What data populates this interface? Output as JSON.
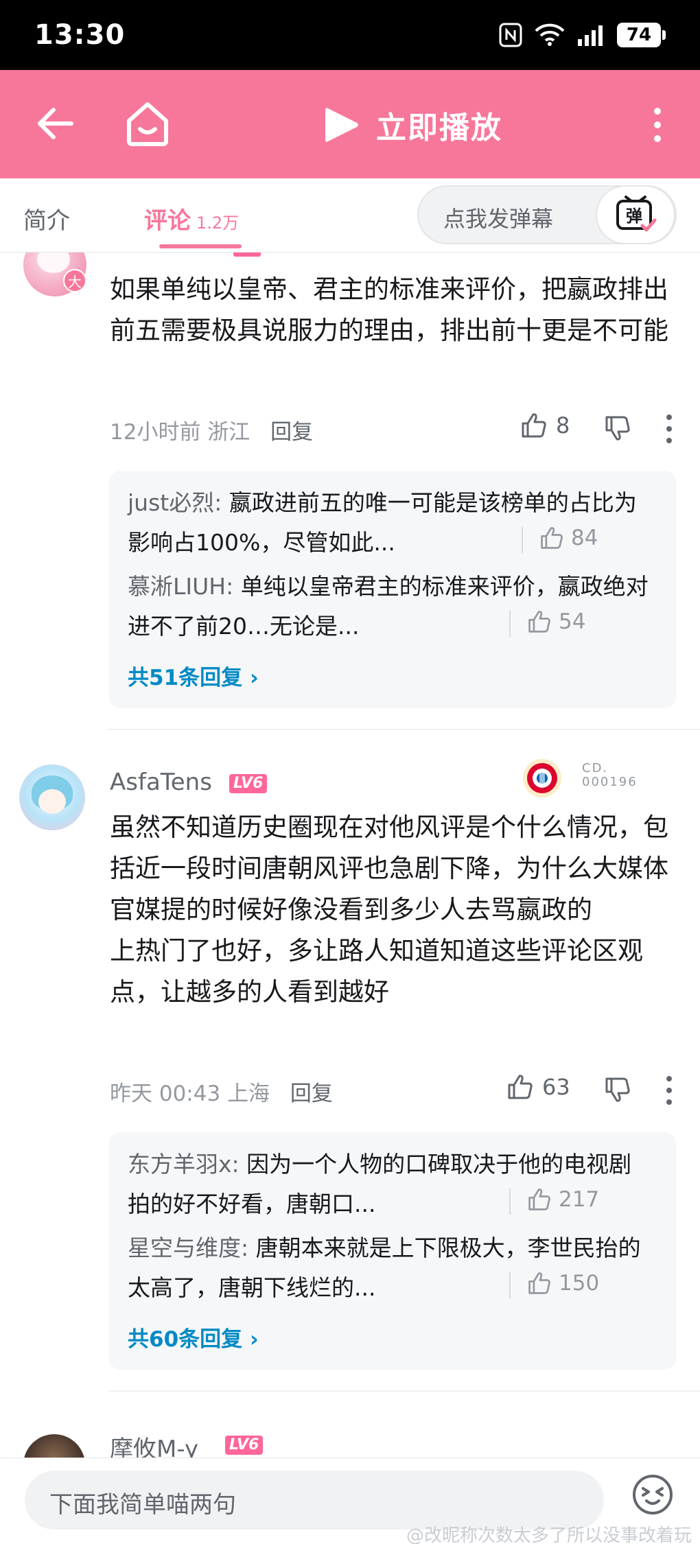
{
  "status_bar": {
    "time": "13:30",
    "battery": "74"
  },
  "toolbar": {
    "play_label": "立即播放"
  },
  "tabs": {
    "intro_label": "简介",
    "comments_label": "评论",
    "comments_count": "1.2万",
    "danmaku_placeholder": "点我发弹幕",
    "danmaku_button": "弹"
  },
  "comments": [
    {
      "badge": "大",
      "text": "如果单纯以皇帝、君主的标准来评价，把嬴政排出前五需要极具说服力的理由，排出前十更是不可能",
      "time": "12小时前",
      "location": "浙江",
      "reply_label": "回复",
      "likes": "8",
      "replies": [
        {
          "name": "just必烈",
          "text": "嬴政进前五的唯一可能是该榜单的占比为影响占100%，尽管如此...",
          "likes": "84"
        },
        {
          "name": "慕淅LIUH",
          "text": "单纯以皇帝君主的标准来评价，嬴政绝对进不了前20…无论是...",
          "likes": "54"
        }
      ],
      "more_replies": "共51条回复"
    },
    {
      "username": "AsfaTens",
      "level": "LV6",
      "fan_id_line1": "CD.",
      "fan_id_line2": "000196",
      "text": "虽然不知道历史圈现在对他风评是个什么情况，包括近一段时间唐朝风评也急剧下降，为什么大媒体官媒提的时候好像没看到多少人去骂嬴政的\n上热门了也好，多让路人知道知道这些评论区观点，让越多的人看到越好",
      "time": "昨天 00:43",
      "location": "上海",
      "reply_label": "回复",
      "likes": "63",
      "replies": [
        {
          "name": "东方羊羽x",
          "text": "因为一个人物的口碑取决于他的电视剧拍的好不好看，唐朝口...",
          "likes": "217"
        },
        {
          "name": "星空与维度",
          "text": "唐朝本来就是上下限极大，李世民抬的太高了，唐朝下线烂的...",
          "likes": "150"
        }
      ],
      "more_replies": "共60条回复"
    },
    {
      "username": "摩攸M-y",
      "level": "LV6"
    }
  ],
  "bottom_bar": {
    "input_placeholder": "下面我简单喵两句",
    "watermark": "@改昵称次数太多了所以没事改着玩"
  },
  "colors": {
    "accent": "#f7779a",
    "level_badge": "#ff6699",
    "link": "#008ac5"
  }
}
